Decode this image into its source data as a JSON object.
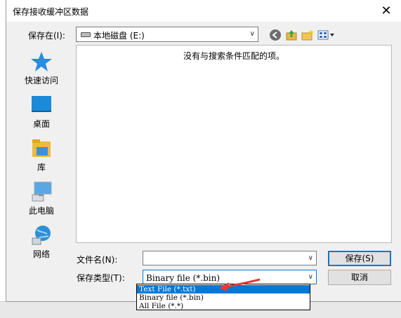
{
  "dialog": {
    "title": "保存接收缓冲区数据",
    "close_glyph": "✕"
  },
  "save_in": {
    "label": "保存在(I):",
    "value": "本地磁盘 (E:)"
  },
  "toolbar": {
    "icons": [
      "back-icon",
      "up-folder-icon",
      "new-folder-icon",
      "view-menu-icon"
    ]
  },
  "places": [
    {
      "label": "快速访问",
      "icon": "star-icon"
    },
    {
      "label": "桌面",
      "icon": "desktop-icon"
    },
    {
      "label": "库",
      "icon": "library-icon"
    },
    {
      "label": "此电脑",
      "icon": "computer-icon"
    },
    {
      "label": "网络",
      "icon": "network-icon"
    }
  ],
  "file_list": {
    "empty_message": "没有与搜索条件匹配的项。"
  },
  "filename": {
    "label": "文件名(N):",
    "value": ""
  },
  "filetype": {
    "label": "保存类型(T):",
    "value": "Binary file (*.bin)",
    "options": [
      "Text File (*.txt)",
      "Binary file (*.bin)",
      "All File (*.*)"
    ],
    "highlighted_index": 0
  },
  "buttons": {
    "save": "保存(S)",
    "cancel": "取消"
  },
  "colors": {
    "accent": "#0078d7",
    "annotation_arrow": "#e53935"
  }
}
